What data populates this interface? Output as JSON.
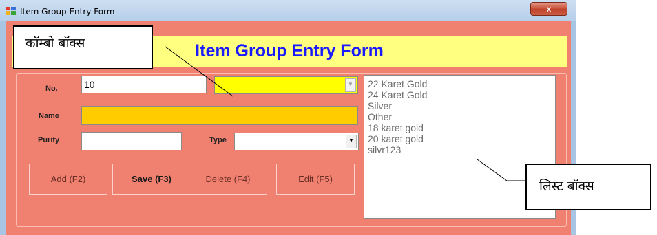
{
  "window": {
    "title": "Item Group Entry Form",
    "close_label": "x"
  },
  "form": {
    "banner_title": "Item Group Entry Form",
    "no_label": "No.",
    "no_value": "10",
    "name_label": "Name",
    "name_value": "",
    "purity_label": "Purity",
    "purity_value": "",
    "type_label": "Type",
    "type_value": "",
    "group_combo_value": ""
  },
  "buttons": {
    "add": "Add (F2)",
    "save": "Save (F3)",
    "delete": "Delete (F4)",
    "edit": "Edit (F5)"
  },
  "listbox": {
    "items": [
      "22 Karet Gold",
      "24 Karet Gold",
      "Silver",
      "Other",
      "18 karet gold",
      "20 karet gold",
      "silvr123"
    ]
  },
  "annotations": {
    "combo_box_label": "कॉम्बो बॉक्स",
    "list_box_label": "लिस्ट बॉक्स"
  },
  "colors": {
    "form_background": "#f08070",
    "banner_background": "#ffff80",
    "banner_text": "#1a1aff",
    "name_field": "#ffcc00",
    "combo_field": "#ffff00"
  },
  "icons": {
    "app": "app-window-icon",
    "close": "close-icon",
    "dropdown": "chevron-down-icon"
  }
}
